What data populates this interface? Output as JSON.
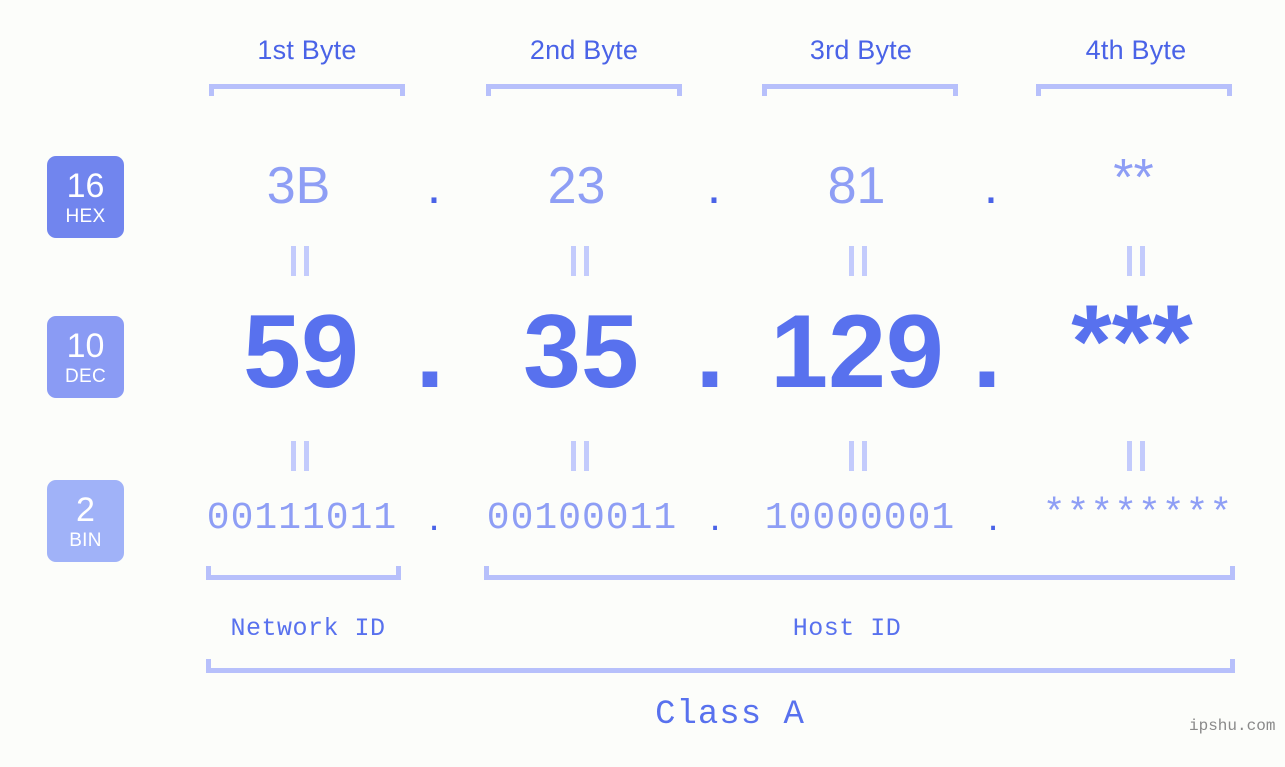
{
  "page": {
    "background_color": "#fcfdfa",
    "accent_color": "#5871ee",
    "light_accent_color": "#8e9ef5",
    "bracket_color": "#b7c0fb"
  },
  "byte_headers": [
    {
      "label": "1st Byte"
    },
    {
      "label": "2nd Byte"
    },
    {
      "label": "3rd Byte"
    },
    {
      "label": "4th Byte"
    }
  ],
  "rows": [
    {
      "badge": {
        "number": "16",
        "name": "HEX",
        "color": "#7185ee"
      },
      "values": [
        "3B",
        "23",
        "81",
        "**"
      ],
      "separator": "."
    },
    {
      "badge": {
        "number": "10",
        "name": "DEC",
        "color": "#8a9bf4"
      },
      "values": [
        "59",
        "35",
        "129",
        "***"
      ],
      "separator": "."
    },
    {
      "badge": {
        "number": "2",
        "name": "BIN",
        "color": "#a0b2f8"
      },
      "values": [
        "00111011",
        "00100011",
        "10000001",
        "********"
      ],
      "separator": "."
    }
  ],
  "equality_marks": {
    "glyph": "=",
    "count_per_gap": 4
  },
  "sections": [
    {
      "label": "Network ID"
    },
    {
      "label": "Host ID"
    }
  ],
  "class_label": "Class A",
  "watermark": "ipshu.com"
}
